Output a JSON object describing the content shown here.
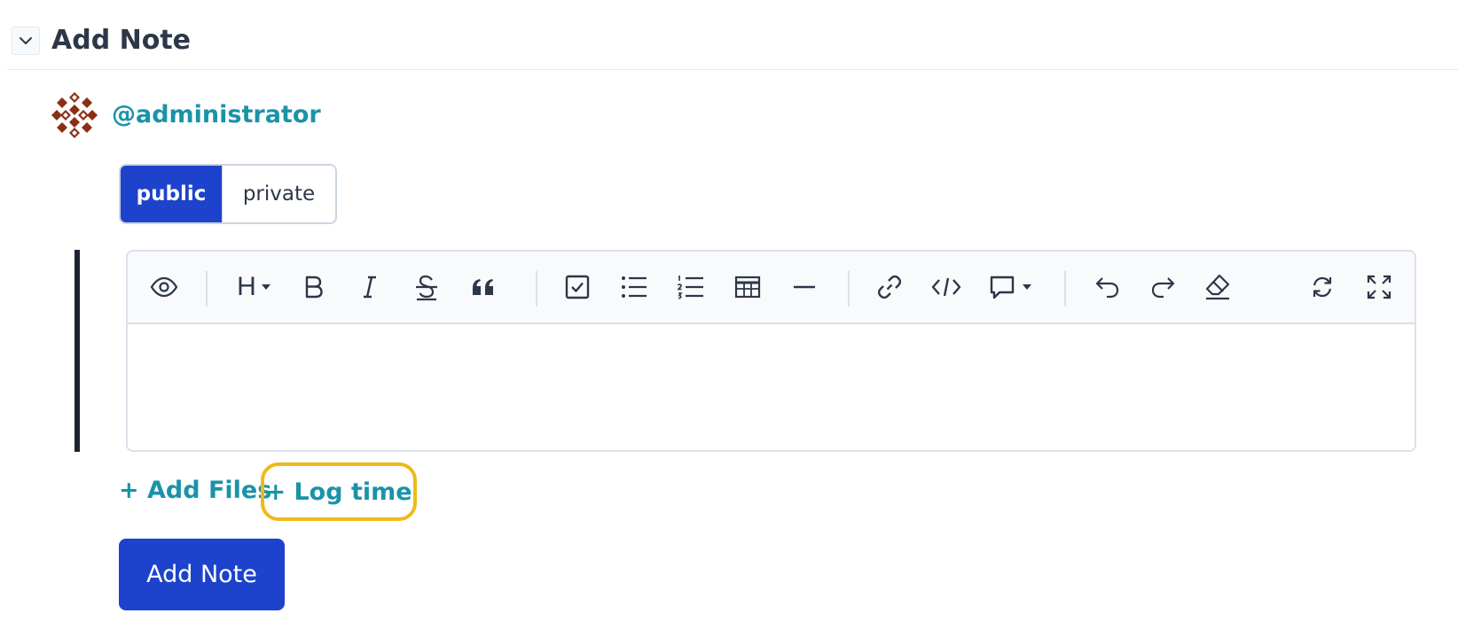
{
  "header": {
    "title": "Add Note",
    "collapse_icon": "chevron-down-icon"
  },
  "author": {
    "username": "@administrator",
    "avatar_color": "#8b2e16"
  },
  "visibility": {
    "options": [
      "public",
      "private"
    ],
    "selected": "public"
  },
  "toolbar": {
    "groups": [
      [
        "preview-icon"
      ],
      [
        "heading-icon",
        "bold-icon",
        "italic-icon",
        "strikethrough-icon",
        "quote-icon"
      ],
      [
        "task-list-icon",
        "bullet-list-icon",
        "numbered-list-icon",
        "table-icon",
        "horizontal-rule-icon"
      ],
      [
        "link-icon",
        "code-icon",
        "comment-icon"
      ],
      [
        "undo-icon",
        "redo-icon",
        "clear-format-icon"
      ],
      [
        "sync-icon",
        "fullscreen-icon"
      ]
    ],
    "heading_label": "H"
  },
  "editor": {
    "content": ""
  },
  "actions": {
    "add_files": "+ Add Files",
    "log_time": "+ Log time",
    "submit": "Add Note"
  },
  "colors": {
    "primary": "#1d43cc",
    "link": "#1a93a8",
    "highlight": "#f0b91a"
  }
}
